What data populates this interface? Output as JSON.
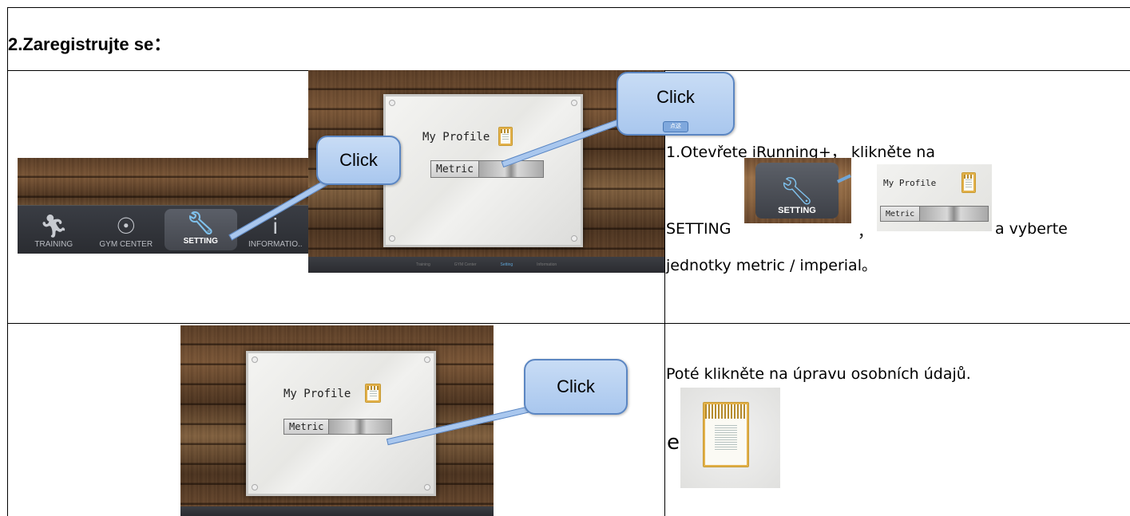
{
  "heading": "2.Zaregistrujte se：",
  "callouts": {
    "click": "Click",
    "mini_tag": "点这"
  },
  "app": {
    "tabs": [
      "TRAINING",
      "GYM CENTER",
      "SETTING",
      "INFORMATIO.."
    ],
    "small_tabs": [
      "Training",
      "GYM Center",
      "Setting",
      "Information"
    ],
    "profile_label": "My Profile",
    "metric_label": "Metric"
  },
  "row1_text": {
    "line1": "1.Otevřete iRunning+，  klikněte na",
    "setting_word": "SETTING",
    "comma": "，",
    "line2_end": "a vyberte",
    "line3": "jednotky metric / imperial。"
  },
  "row2_text": {
    "line1": "Poté klikněte na úpravu osobních údajů.",
    "letter": "e"
  },
  "colors": {
    "callout_fill": "#a9c7ee",
    "callout_border": "#5b86c2",
    "active_icon": "#7fc1ec"
  }
}
